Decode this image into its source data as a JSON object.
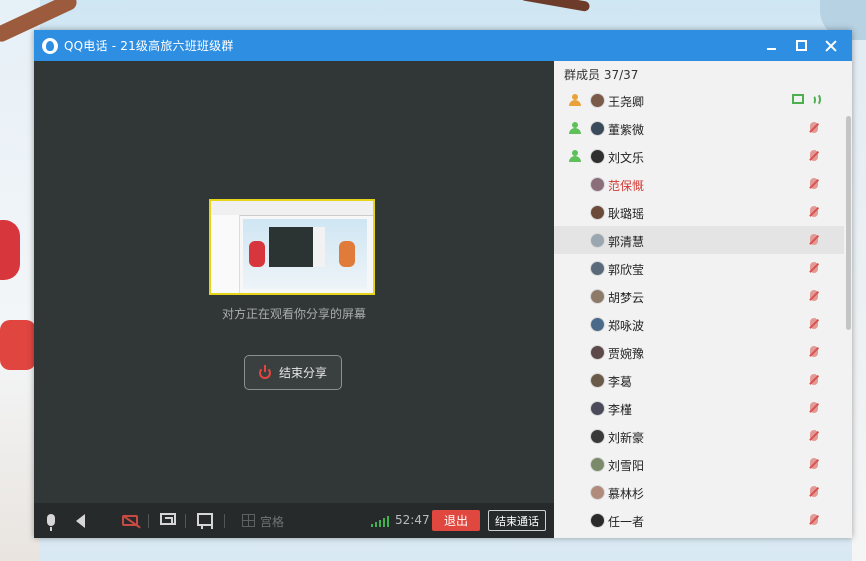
{
  "window": {
    "title": "QQ电话 - 21级高旅六班班级群"
  },
  "main": {
    "watch_text": "对方正在观看你分享的屏幕",
    "end_share_label": "结束分享"
  },
  "toolbar": {
    "grid_label": "宫格",
    "timer": "52:47",
    "exit_label": "退出",
    "end_call_label": "结束通话"
  },
  "sidebar": {
    "header": "群成员 37/37",
    "members": [
      {
        "name": "王尧卿",
        "role": "orange",
        "status": "sharing"
      },
      {
        "name": "董紫微",
        "role": "green",
        "status": "muted"
      },
      {
        "name": "刘文乐",
        "role": "green",
        "status": "muted"
      },
      {
        "name": "范保慨",
        "role": "none",
        "status": "muted",
        "red": true
      },
      {
        "name": "耿璐瑶",
        "role": "none",
        "status": "muted"
      },
      {
        "name": "郭清慧",
        "role": "none",
        "status": "muted"
      },
      {
        "name": "郭欣莹",
        "role": "none",
        "status": "muted"
      },
      {
        "name": "胡梦云",
        "role": "none",
        "status": "muted"
      },
      {
        "name": "郑咏波",
        "role": "none",
        "status": "muted"
      },
      {
        "name": "贾婉豫",
        "role": "none",
        "status": "muted"
      },
      {
        "name": "李葛",
        "role": "none",
        "status": "muted"
      },
      {
        "name": "李槿",
        "role": "none",
        "status": "muted"
      },
      {
        "name": "刘新豪",
        "role": "none",
        "status": "muted"
      },
      {
        "name": "刘雪阳",
        "role": "none",
        "status": "muted"
      },
      {
        "name": "慕林杉",
        "role": "none",
        "status": "muted"
      },
      {
        "name": "任一者",
        "role": "none",
        "status": "muted"
      }
    ]
  },
  "colors": {
    "title_bar": "#2e8ee2",
    "exit_button": "#e0473f",
    "share_frame": "#e6d41b",
    "signal": "#3fb34f"
  }
}
